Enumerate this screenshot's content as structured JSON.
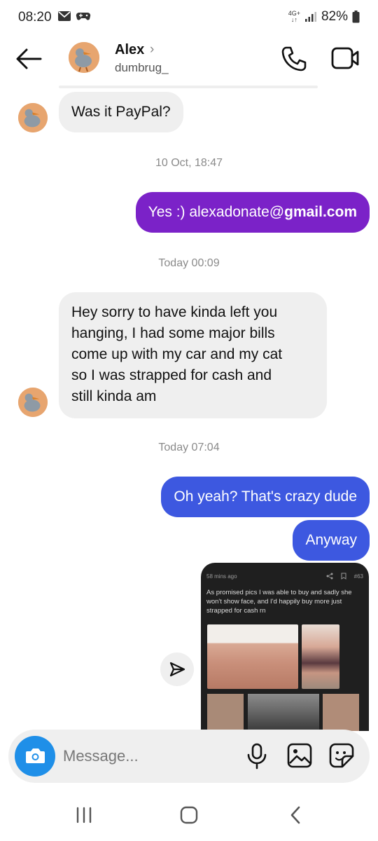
{
  "status_bar": {
    "time": "08:20",
    "network": "4G+",
    "battery": "82%"
  },
  "header": {
    "name": "Alex",
    "username": "dumbrug_"
  },
  "messages": [
    {
      "type": "incoming",
      "text": "Was it PayPal?"
    },
    {
      "type": "timestamp",
      "text": "10 Oct, 18:47"
    },
    {
      "type": "outgoing",
      "text_prefix": "Yes :) alexadonate@",
      "text_bold": "gmail.com",
      "color": "#7b22c8"
    },
    {
      "type": "timestamp",
      "text": "Today 00:09"
    },
    {
      "type": "incoming",
      "lines": [
        "Hey sorry to have kinda left you",
        "hanging, I had some major bills",
        "come up with my car and my cat",
        "so I was strapped for cash and",
        "still kinda am"
      ]
    },
    {
      "type": "timestamp",
      "text": "Today 07:04"
    },
    {
      "type": "outgoing",
      "text": "Oh yeah? That's crazy dude",
      "color": "#3d58e0"
    },
    {
      "type": "outgoing",
      "text": "Anyway",
      "color": "#3d58e0"
    }
  ],
  "shared_post": {
    "meta": "58 mins ago",
    "count": "#63",
    "text": "As promised pics I was able to buy and sadly she won't show face, and I'd happily buy more just strapped for cash rn"
  },
  "composer": {
    "placeholder": "Message..."
  },
  "colors": {
    "purple_bubble": "#7b22c8",
    "blue_bubble": "#3d58e0",
    "camera_button": "#1f8fe8"
  }
}
